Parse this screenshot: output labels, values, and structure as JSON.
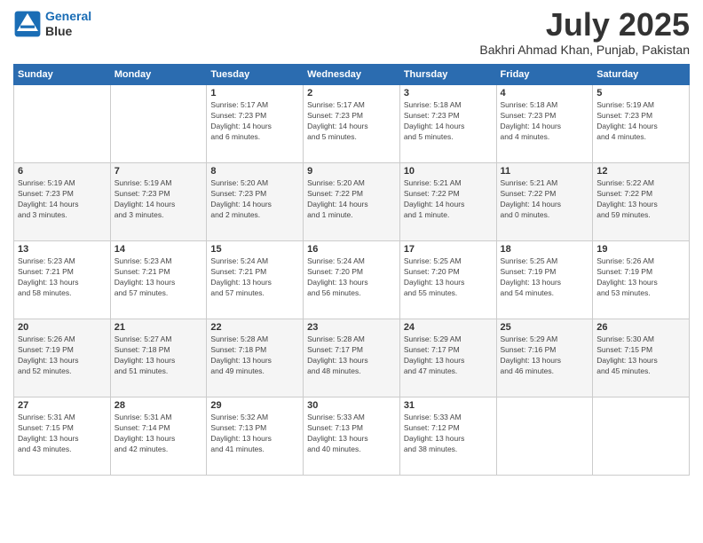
{
  "header": {
    "logo_line1": "General",
    "logo_line2": "Blue",
    "month_year": "July 2025",
    "location": "Bakhri Ahmad Khan, Punjab, Pakistan"
  },
  "weekdays": [
    "Sunday",
    "Monday",
    "Tuesday",
    "Wednesday",
    "Thursday",
    "Friday",
    "Saturday"
  ],
  "weeks": [
    [
      {
        "day": "",
        "info": ""
      },
      {
        "day": "",
        "info": ""
      },
      {
        "day": "1",
        "info": "Sunrise: 5:17 AM\nSunset: 7:23 PM\nDaylight: 14 hours\nand 6 minutes."
      },
      {
        "day": "2",
        "info": "Sunrise: 5:17 AM\nSunset: 7:23 PM\nDaylight: 14 hours\nand 5 minutes."
      },
      {
        "day": "3",
        "info": "Sunrise: 5:18 AM\nSunset: 7:23 PM\nDaylight: 14 hours\nand 5 minutes."
      },
      {
        "day": "4",
        "info": "Sunrise: 5:18 AM\nSunset: 7:23 PM\nDaylight: 14 hours\nand 4 minutes."
      },
      {
        "day": "5",
        "info": "Sunrise: 5:19 AM\nSunset: 7:23 PM\nDaylight: 14 hours\nand 4 minutes."
      }
    ],
    [
      {
        "day": "6",
        "info": "Sunrise: 5:19 AM\nSunset: 7:23 PM\nDaylight: 14 hours\nand 3 minutes."
      },
      {
        "day": "7",
        "info": "Sunrise: 5:19 AM\nSunset: 7:23 PM\nDaylight: 14 hours\nand 3 minutes."
      },
      {
        "day": "8",
        "info": "Sunrise: 5:20 AM\nSunset: 7:23 PM\nDaylight: 14 hours\nand 2 minutes."
      },
      {
        "day": "9",
        "info": "Sunrise: 5:20 AM\nSunset: 7:22 PM\nDaylight: 14 hours\nand 1 minute."
      },
      {
        "day": "10",
        "info": "Sunrise: 5:21 AM\nSunset: 7:22 PM\nDaylight: 14 hours\nand 1 minute."
      },
      {
        "day": "11",
        "info": "Sunrise: 5:21 AM\nSunset: 7:22 PM\nDaylight: 14 hours\nand 0 minutes."
      },
      {
        "day": "12",
        "info": "Sunrise: 5:22 AM\nSunset: 7:22 PM\nDaylight: 13 hours\nand 59 minutes."
      }
    ],
    [
      {
        "day": "13",
        "info": "Sunrise: 5:23 AM\nSunset: 7:21 PM\nDaylight: 13 hours\nand 58 minutes."
      },
      {
        "day": "14",
        "info": "Sunrise: 5:23 AM\nSunset: 7:21 PM\nDaylight: 13 hours\nand 57 minutes."
      },
      {
        "day": "15",
        "info": "Sunrise: 5:24 AM\nSunset: 7:21 PM\nDaylight: 13 hours\nand 57 minutes."
      },
      {
        "day": "16",
        "info": "Sunrise: 5:24 AM\nSunset: 7:20 PM\nDaylight: 13 hours\nand 56 minutes."
      },
      {
        "day": "17",
        "info": "Sunrise: 5:25 AM\nSunset: 7:20 PM\nDaylight: 13 hours\nand 55 minutes."
      },
      {
        "day": "18",
        "info": "Sunrise: 5:25 AM\nSunset: 7:19 PM\nDaylight: 13 hours\nand 54 minutes."
      },
      {
        "day": "19",
        "info": "Sunrise: 5:26 AM\nSunset: 7:19 PM\nDaylight: 13 hours\nand 53 minutes."
      }
    ],
    [
      {
        "day": "20",
        "info": "Sunrise: 5:26 AM\nSunset: 7:19 PM\nDaylight: 13 hours\nand 52 minutes."
      },
      {
        "day": "21",
        "info": "Sunrise: 5:27 AM\nSunset: 7:18 PM\nDaylight: 13 hours\nand 51 minutes."
      },
      {
        "day": "22",
        "info": "Sunrise: 5:28 AM\nSunset: 7:18 PM\nDaylight: 13 hours\nand 49 minutes."
      },
      {
        "day": "23",
        "info": "Sunrise: 5:28 AM\nSunset: 7:17 PM\nDaylight: 13 hours\nand 48 minutes."
      },
      {
        "day": "24",
        "info": "Sunrise: 5:29 AM\nSunset: 7:17 PM\nDaylight: 13 hours\nand 47 minutes."
      },
      {
        "day": "25",
        "info": "Sunrise: 5:29 AM\nSunset: 7:16 PM\nDaylight: 13 hours\nand 46 minutes."
      },
      {
        "day": "26",
        "info": "Sunrise: 5:30 AM\nSunset: 7:15 PM\nDaylight: 13 hours\nand 45 minutes."
      }
    ],
    [
      {
        "day": "27",
        "info": "Sunrise: 5:31 AM\nSunset: 7:15 PM\nDaylight: 13 hours\nand 43 minutes."
      },
      {
        "day": "28",
        "info": "Sunrise: 5:31 AM\nSunset: 7:14 PM\nDaylight: 13 hours\nand 42 minutes."
      },
      {
        "day": "29",
        "info": "Sunrise: 5:32 AM\nSunset: 7:13 PM\nDaylight: 13 hours\nand 41 minutes."
      },
      {
        "day": "30",
        "info": "Sunrise: 5:33 AM\nSunset: 7:13 PM\nDaylight: 13 hours\nand 40 minutes."
      },
      {
        "day": "31",
        "info": "Sunrise: 5:33 AM\nSunset: 7:12 PM\nDaylight: 13 hours\nand 38 minutes."
      },
      {
        "day": "",
        "info": ""
      },
      {
        "day": "",
        "info": ""
      }
    ]
  ]
}
